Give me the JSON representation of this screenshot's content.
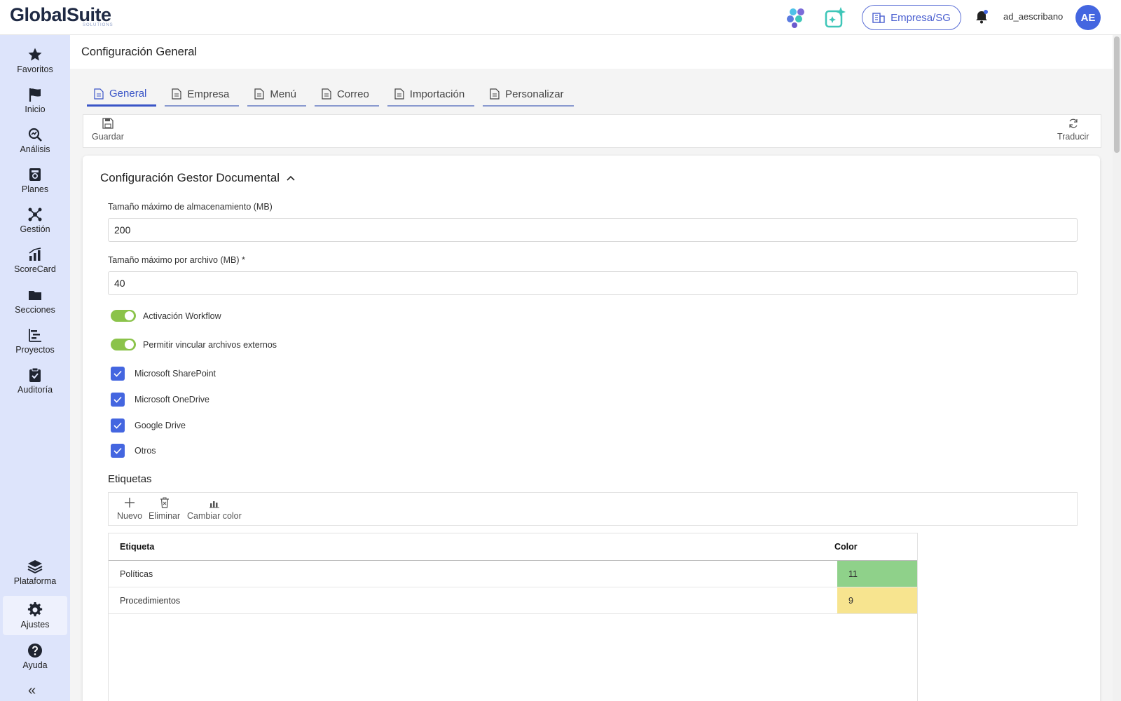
{
  "header": {
    "logo_main": "GlobalSuite",
    "logo_sub": "SOLUTIONS",
    "company_label": "Empresa/SG",
    "username": "ad_aescribano",
    "avatar_initials": "AE",
    "accent_color": "#4466e0"
  },
  "sidebar": {
    "items": [
      {
        "label": "Favoritos",
        "icon": "star-icon"
      },
      {
        "label": "Inicio",
        "icon": "flag-icon"
      },
      {
        "label": "Análisis",
        "icon": "analysis-icon"
      },
      {
        "label": "Planes",
        "icon": "plans-icon"
      },
      {
        "label": "Gestión",
        "icon": "network-icon"
      },
      {
        "label": "ScoreCard",
        "icon": "chart-icon"
      },
      {
        "label": "Secciones",
        "icon": "folder-icon"
      },
      {
        "label": "Proyectos",
        "icon": "gantt-icon"
      },
      {
        "label": "Auditoría",
        "icon": "clipboard-check-icon"
      }
    ],
    "bottom_items": [
      {
        "label": "Plataforma",
        "icon": "layers-icon"
      },
      {
        "label": "Ajustes",
        "icon": "gear-icon"
      },
      {
        "label": "Ayuda",
        "icon": "help-icon"
      }
    ],
    "collapse_glyph": "«"
  },
  "page": {
    "title": "Configuración General"
  },
  "tabs": [
    {
      "label": "General",
      "active": true
    },
    {
      "label": "Empresa",
      "active": false
    },
    {
      "label": "Menú",
      "active": false
    },
    {
      "label": "Correo",
      "active": false
    },
    {
      "label": "Importación",
      "active": false
    },
    {
      "label": "Personalizar",
      "active": false
    }
  ],
  "toolbar": {
    "save_label": "Guardar",
    "translate_label": "Traducir"
  },
  "section": {
    "title": "Configuración Gestor Documental",
    "storage_label": "Tamaño máximo de almacenamiento (MB)",
    "storage_value": "200",
    "file_label": "Tamaño máximo por archivo (MB) *",
    "file_value": "40",
    "switches": [
      {
        "label": "Activación Workflow",
        "on": true
      },
      {
        "label": "Permitir vincular archivos externos",
        "on": true
      }
    ],
    "checkboxes": [
      {
        "label": "Microsoft SharePoint",
        "checked": true
      },
      {
        "label": "Microsoft OneDrive",
        "checked": true
      },
      {
        "label": "Google Drive",
        "checked": true
      },
      {
        "label": "Otros",
        "checked": true
      }
    ]
  },
  "etiquetas": {
    "title": "Etiquetas",
    "toolbar": {
      "new_label": "Nuevo",
      "delete_label": "Eliminar",
      "color_label": "Cambiar color"
    },
    "columns": {
      "etiqueta": "Etiqueta",
      "color": "Color"
    },
    "rows": [
      {
        "etiqueta": "Políticas",
        "color_value": "11",
        "color": "#8fd18a"
      },
      {
        "etiqueta": "Procedimientos",
        "color_value": "9",
        "color": "#f7e48f"
      }
    ]
  }
}
